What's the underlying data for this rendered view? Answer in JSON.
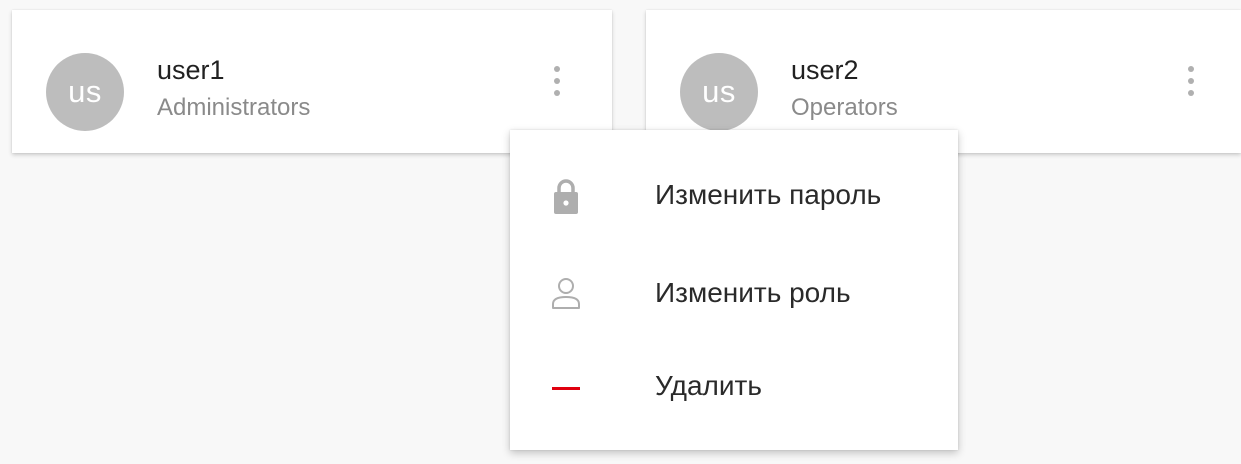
{
  "users": [
    {
      "initials": "us",
      "name": "user1",
      "group": "Administrators"
    },
    {
      "initials": "us",
      "name": "user2",
      "group": "Operators"
    }
  ],
  "context_menu": {
    "items": [
      {
        "label": "Изменить пароль",
        "icon": "lock-icon"
      },
      {
        "label": "Изменить роль",
        "icon": "person-icon"
      },
      {
        "label": "Удалить",
        "icon": "minus-icon"
      }
    ]
  },
  "colors": {
    "background": "#f8f8f8",
    "card": "#ffffff",
    "avatar": "#bdbdbd",
    "secondary_text": "#8a8a8a",
    "icon_gray": "#aeaeae",
    "delete_red": "#e0000f"
  }
}
